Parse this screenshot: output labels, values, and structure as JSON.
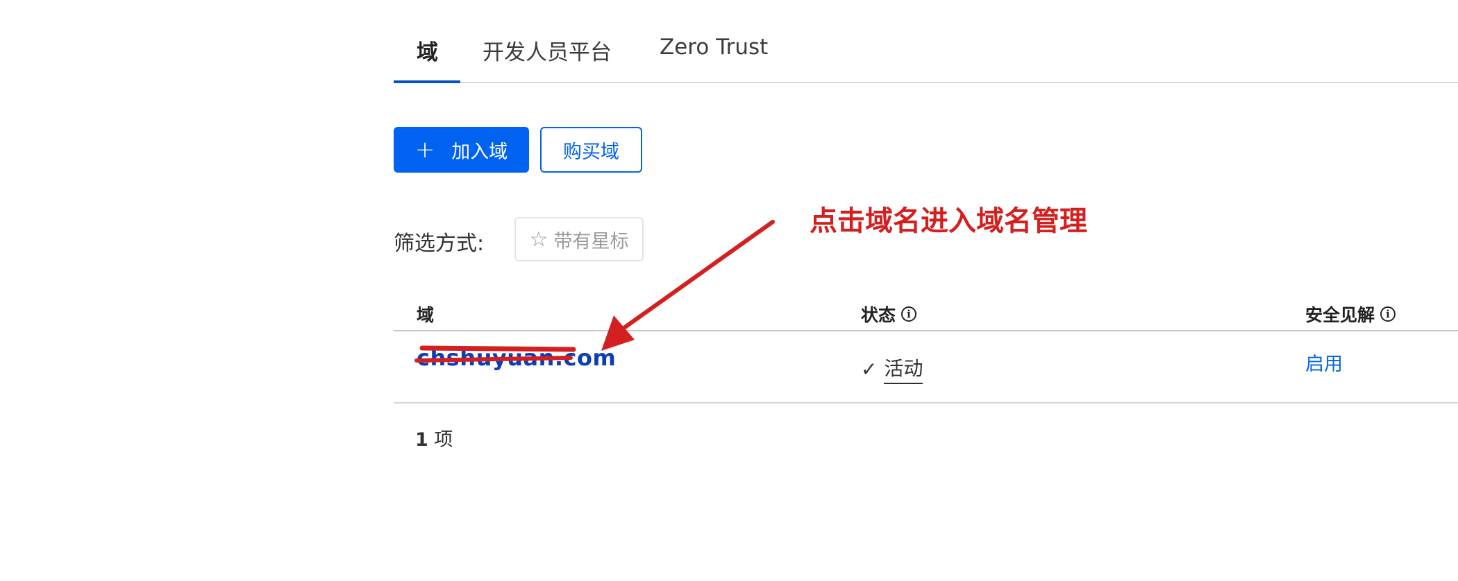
{
  "tabs": [
    {
      "label": "域",
      "active": true
    },
    {
      "label": "开发人员平台",
      "active": false
    },
    {
      "label": "Zero Trust",
      "active": false
    }
  ],
  "actions": {
    "add_domain_label": "加入域",
    "buy_domain_label": "购买域"
  },
  "filter": {
    "label": "筛选方式:",
    "starred_chip": "带有星标"
  },
  "annotation": {
    "text": "点击域名进入域名管理"
  },
  "table": {
    "headers": {
      "domain": "域",
      "status": "状态",
      "security": "安全见解"
    },
    "rows": [
      {
        "domain": "chshuyuan.com",
        "status": "活动",
        "security": "启用"
      }
    ],
    "count_number": "1",
    "count_unit": "项"
  },
  "colors": {
    "primary": "#0062f0",
    "tab_underline": "#0051c3",
    "annotation": "#d41f1f",
    "domain_link": "#0b3db8"
  },
  "icons": {
    "plus": "plus-icon",
    "star": "star-outline-icon",
    "info": "info-circle-icon",
    "check": "check-icon"
  }
}
